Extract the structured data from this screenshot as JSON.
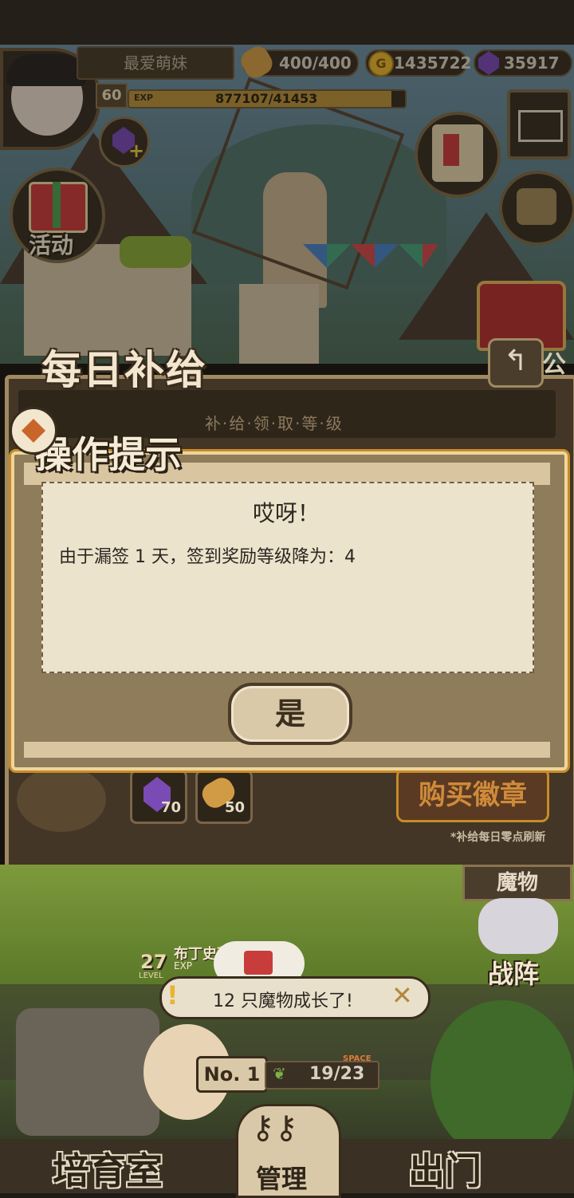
{
  "header": {
    "player_name": "最爱萌妹",
    "level": "60",
    "exp_label": "EXP",
    "exp_value": "877107/41453",
    "exp_fraction": 0.95,
    "bread": "400/400",
    "gold": "1435722",
    "gems": "35917"
  },
  "side": {
    "activity_label": "活动",
    "notice_label": "公"
  },
  "daily": {
    "title": "每日补给",
    "level_label": "补·给·领·取·等·级",
    "rewards": [
      {
        "icon": "purple-gem-icon",
        "count": "70"
      },
      {
        "icon": "bread-icon",
        "count": "50"
      }
    ],
    "buy_badge_label": "购买徽章",
    "refresh_note": "*补给每日零点刷新"
  },
  "dialog": {
    "title": "操作提示",
    "heading": "哎呀！",
    "message": "由于漏签 1 天，签到奖励等级降为：4",
    "yes_label": "是"
  },
  "bottom": {
    "monster_label": "魔物",
    "formation_label": "战阵",
    "pet_level": "27",
    "pet_level_label": "LEVEL",
    "pet_name": "布丁史莱",
    "pet_exp_label": "EXP",
    "growth_notice": "12 只魔物成长了!",
    "rank_label": "No. 1",
    "space_label": "SPACE",
    "space_value": "19/23",
    "nav": {
      "nursery": "培育室",
      "manage": "管理",
      "outing": "出门"
    }
  },
  "colors": {
    "gold": "#e8b431",
    "gem": "#7a4bb4",
    "panel": "#433626",
    "dialog_border": "#f0d49a"
  }
}
